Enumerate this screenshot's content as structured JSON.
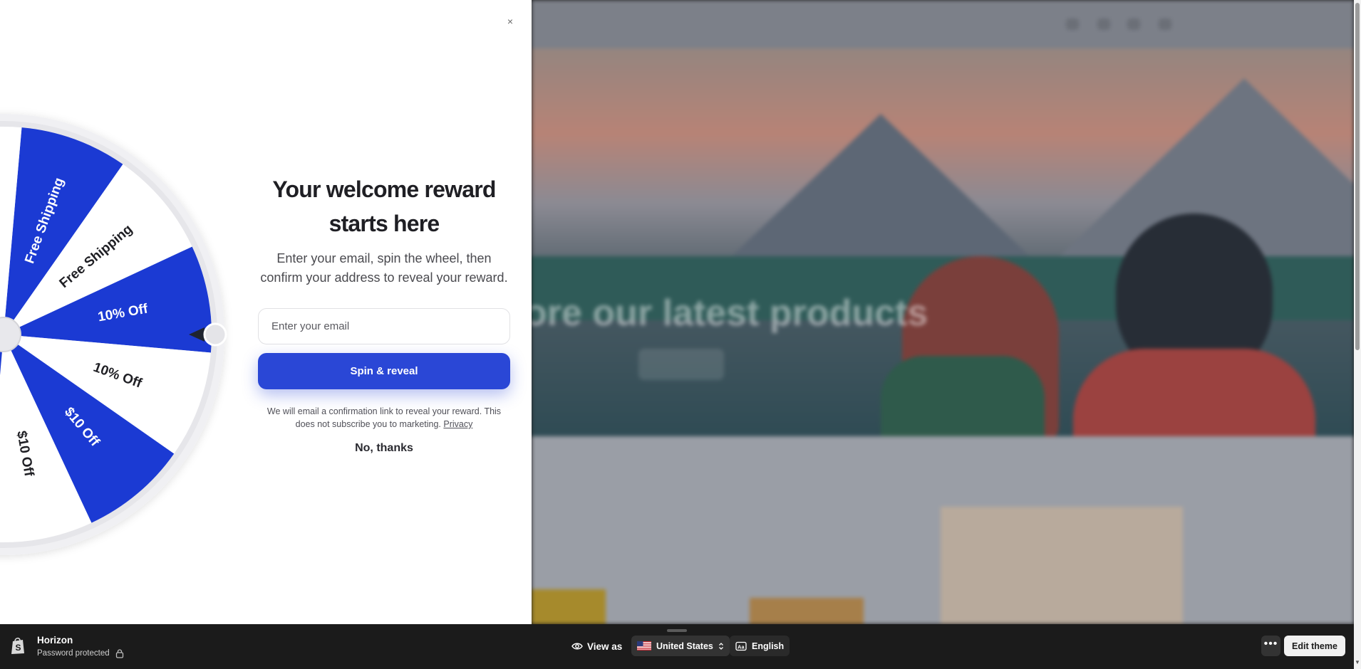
{
  "popup": {
    "close_label": "×",
    "headline": "Your welcome reward starts here",
    "subtext": "Enter your email, spin the wheel, then confirm your address to reveal your reward.",
    "email_placeholder": "Enter your email",
    "spin_button_label": "Spin & reveal",
    "disclaimer": "We will email a confirmation link to reveal your reward. This does not subscribe you to marketing.",
    "privacy_label": "Privacy",
    "no_thanks_label": "No, thanks"
  },
  "wheel": {
    "colors": {
      "blue": "#1b3ad3",
      "white": "#ffffff"
    },
    "segments": [
      {
        "label": "Free Shipping",
        "color": "blue"
      },
      {
        "label": "Free Shipping",
        "color": "white"
      },
      {
        "label": "10% Off",
        "color": "blue"
      },
      {
        "label": "10% Off",
        "color": "white"
      },
      {
        "label": "$10 Off",
        "color": "blue"
      },
      {
        "label": "$10 Off",
        "color": "white"
      }
    ]
  },
  "admin_bar": {
    "store_name": "Horizon",
    "store_status": "Password protected",
    "view_as_label": "View as",
    "country_label": "United States",
    "language_label": "English",
    "more_label": "•••",
    "edit_theme_label": "Edit theme"
  },
  "storefront": {
    "hero_text": "ore our latest products"
  }
}
